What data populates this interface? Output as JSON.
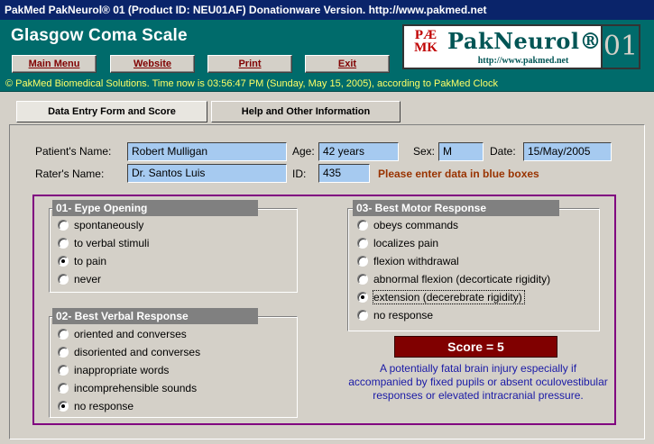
{
  "window": {
    "title": "PakMed PakNeurol® 01 (Product ID: NEU01AF) Donationware Version. http://www.pakmed.net"
  },
  "header": {
    "app_title": "Glasgow Coma Scale",
    "buttons": {
      "main_menu": "Main Menu",
      "website": "Website",
      "print": "Print",
      "exit": "Exit"
    },
    "status": "© PakMed Biomedical Solutions. Time now is 03:56:47 PM (Sunday, May 15, 2005), according to PakMed Clock"
  },
  "logo": {
    "mark_line1": "PÆ",
    "mark_line2": "MK",
    "name": "PakNeurol®",
    "url": "http://www.pakmed.net",
    "number": "01"
  },
  "tabs": {
    "data_entry": "Data Entry Form and Score",
    "help": "Help and Other Information"
  },
  "patient": {
    "name_label": "Patient's Name:",
    "name_value": "Robert Mulligan",
    "age_label": "Age:",
    "age_value": "42 years",
    "sex_label": "Sex:",
    "sex_value": "M",
    "date_label": "Date:",
    "date_value": "15/May/2005",
    "rater_label": "Rater's Name:",
    "rater_value": "Dr. Santos Luis",
    "id_label": "ID:",
    "id_value": "435",
    "hint": "Please enter data in blue boxes"
  },
  "eye": {
    "heading": "01- Eype Opening",
    "selected_index": 2,
    "options": [
      "spontaneously",
      "to verbal stimuli",
      "to pain",
      "never"
    ]
  },
  "verbal": {
    "heading": "02- Best Verbal Response",
    "selected_index": 4,
    "options": [
      "oriented and converses",
      "disoriented and converses",
      "inappropriate words",
      "incomprehensible sounds",
      "no response"
    ]
  },
  "motor": {
    "heading": "03- Best Motor Response",
    "selected_index": 4,
    "options": [
      "obeys commands",
      "localizes pain",
      "flexion withdrawal",
      "abnormal flexion (decorticate rigidity)",
      "extension (decerebrate rigidity)",
      "no response"
    ]
  },
  "score": {
    "label": "Score = 5"
  },
  "note": "A potentially fatal brain injury especially if accompanied by fixed pupils or absent oculovestibular responses or elevated intracranial pressure.",
  "colors": {
    "header_bg": "#006b6b",
    "field_bg": "#a6caf0",
    "score_bg": "#800000",
    "frame": "#800080"
  }
}
